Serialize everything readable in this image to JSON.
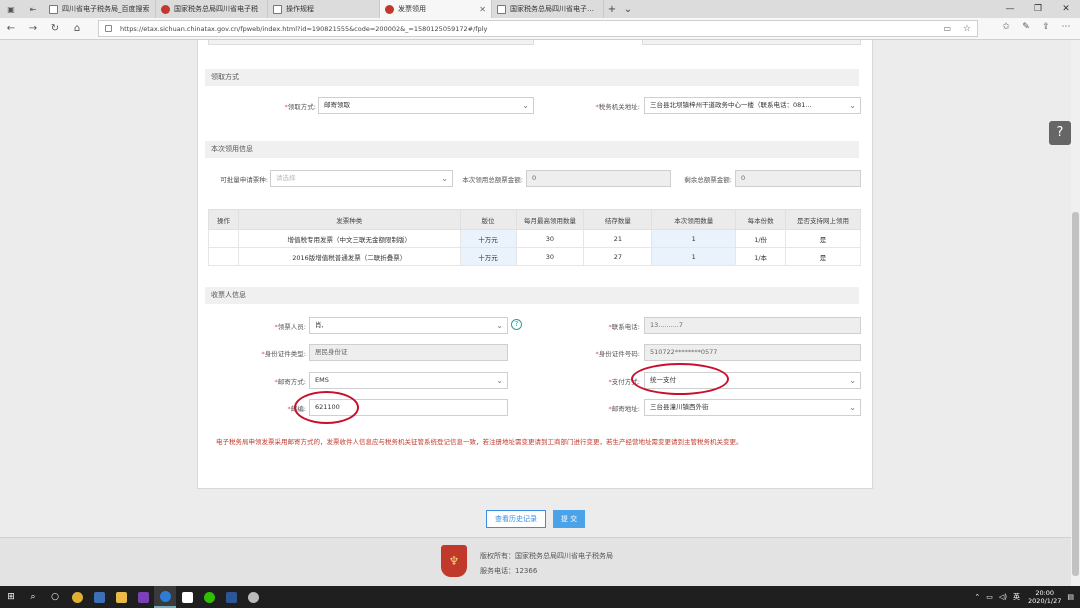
{
  "browser": {
    "tabs": [
      {
        "label": "四川省电子税务局_百度搜索",
        "favicon": "page-icon",
        "active": false
      },
      {
        "label": "国家税务总局四川省电子税",
        "favicon": "tax-emblem-icon",
        "active": false
      },
      {
        "label": "操作规程",
        "favicon": "page-icon",
        "active": false
      },
      {
        "label": "发票领用",
        "favicon": "tax-emblem-icon",
        "active": true
      },
      {
        "label": "国家税务总局四川省电子税务",
        "favicon": "page-icon",
        "active": false
      }
    ],
    "url": "https://etax.sichuan.chinatax.gov.cn/fpweb/index.html?id=190821555&code=200002&_=1580125059172#/fply"
  },
  "receive": {
    "section_title": "领取方式",
    "method_label": "领取方式:",
    "method_value": "邮寄领取",
    "office_label": "税务机关地址:",
    "office_value": "三台县北坝镇梓州干道政务中心一楼（联系电话：081..."
  },
  "current": {
    "section_title": "本次领用信息",
    "type_label": "可批量申请票种:",
    "type_placeholder": "请选择",
    "amount_label": "本次领用总额票金额:",
    "amount_value": "0",
    "remain_label": "剩余总额票金额:",
    "remain_value": "0"
  },
  "table": {
    "headers": [
      "操作",
      "发票种类",
      "版位",
      "每月最高领用数量",
      "结存数量",
      "本次领用数量",
      "每本份数",
      "是否支持网上领用"
    ],
    "rows": [
      [
        "",
        "增值税专用发票（中文三联无金额限制版）",
        "十万元",
        "30",
        "21",
        "1",
        "1/份",
        "是"
      ],
      [
        "",
        "2016版增值税普通发票（二联折叠票）",
        "十万元",
        "30",
        "27",
        "1",
        "1/本",
        "是"
      ]
    ]
  },
  "recipient": {
    "section_title": "收票人信息",
    "person_label": "领票人员:",
    "person_value": "肖,",
    "phone_label": "联系电话:",
    "phone_value": "13..........7",
    "idtype_label": "身份证件类型:",
    "idtype_value": "居民身份证",
    "idno_label": "身份证件号码:",
    "idno_value": "510722********0577",
    "mail_label": "邮寄方式:",
    "mail_value": "EMS",
    "pay_label": "支付方式:",
    "pay_value": "统一支付",
    "zip_label": "邮编:",
    "zip_value": "621100",
    "addr_label": "邮寄地址:",
    "addr_value": "三台县潼川镇西外街"
  },
  "notice": "电子税务局申领发票采用邮寄方式的，发票收件人信息应与税务机关征管系统登记信息一致，若注册地址需变更请到工商部门进行变更，若生产经营地址需变更请到主管税务机关变更。",
  "actions": {
    "history_label": "查看历史记录",
    "submit_label": "提 交"
  },
  "footer": {
    "copyright": "版权所有：国家税务总局四川省电子税务局",
    "phone": "服务电话：12366"
  },
  "taskbar": {
    "time": "20:00",
    "date": "2020/1/27",
    "ime": "英"
  },
  "colors": {
    "accent": "#3a8ee6",
    "annotation": "#c8102e",
    "notice": "#c0392b"
  }
}
